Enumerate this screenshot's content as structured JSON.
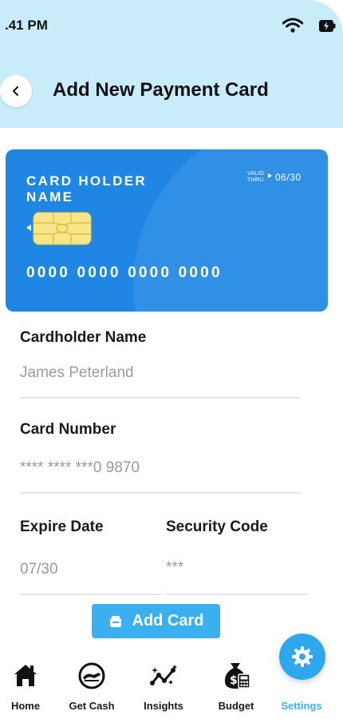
{
  "status_bar": {
    "time": ".41 PM",
    "icons": [
      "wifi-icon",
      "battery-charging-icon"
    ]
  },
  "header": {
    "back_icon": "chevron-left-icon",
    "title": "Add New Payment Card"
  },
  "card_preview": {
    "holder_label": "CARD HOLDER NAME",
    "valid_thru_label": "VALID THRU",
    "valid_thru": "06/30",
    "number": "0000 0000 0000 0000",
    "color": "#1f87e3",
    "chip_icon": "chip-icon"
  },
  "form": {
    "cardholder": {
      "label": "Cardholder Name",
      "value": "James Peterland"
    },
    "card_number": {
      "label": "Card Number",
      "value": "**** **** ***0 9870"
    },
    "expire": {
      "label": "Expire Date",
      "value": "07/30"
    },
    "security": {
      "label": "Security Code",
      "value": "***"
    },
    "submit_label": "Add Card",
    "submit_icon": "wallet-icon"
  },
  "fab": {
    "icon": "gear-icon",
    "color": "#2ea7ee"
  },
  "bottom_nav": {
    "items": [
      {
        "label": "Home",
        "icon": "home-icon"
      },
      {
        "label": "Get Cash",
        "icon": "cash-icon"
      },
      {
        "label": "Insights",
        "icon": "insights-icon"
      },
      {
        "label": "Budget",
        "icon": "budget-icon"
      },
      {
        "label": "Settings",
        "icon": "settings-icon",
        "active": true
      }
    ],
    "active_color": "#3ab0f0"
  }
}
